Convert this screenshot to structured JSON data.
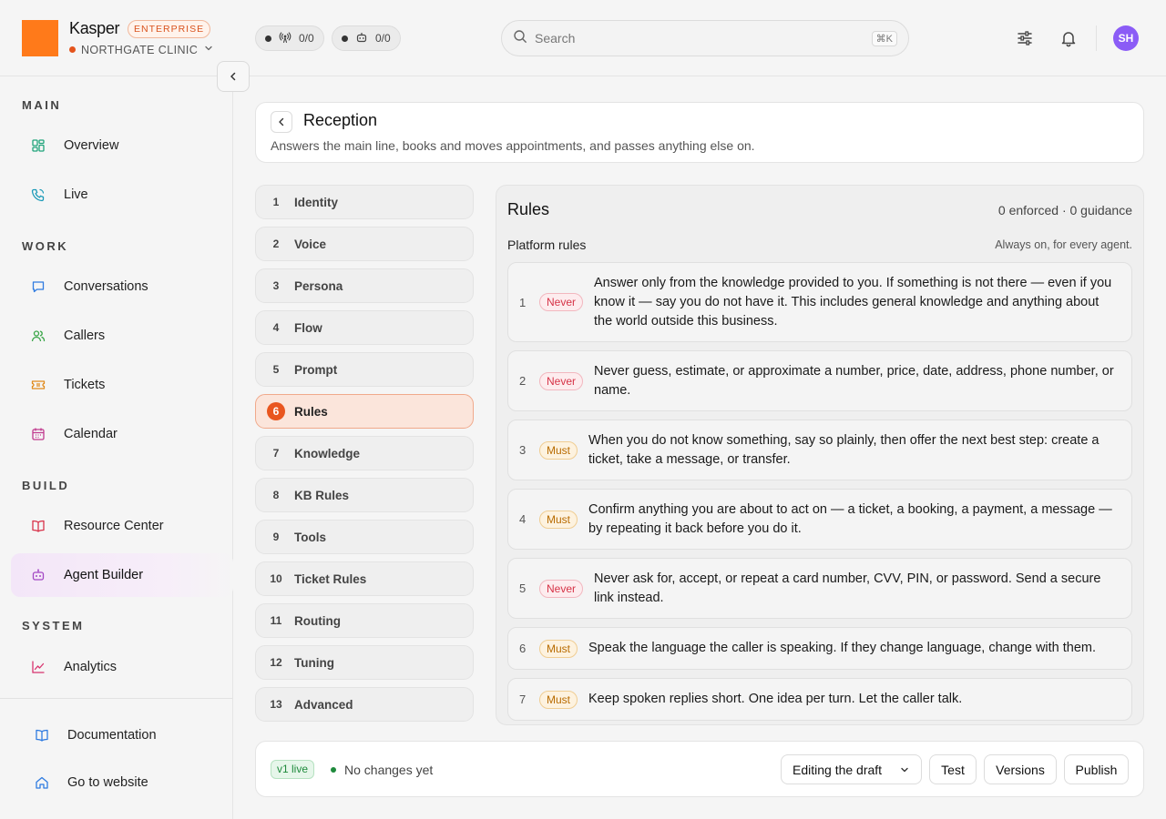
{
  "header": {
    "brand": "Kasper",
    "plan_badge": "ENTERPRISE",
    "org_name": "NORTHGATE CLINIC",
    "chips": [
      {
        "icon": "broadcast-icon",
        "value": "0/0"
      },
      {
        "icon": "robot-icon",
        "value": "0/0"
      }
    ],
    "search": {
      "placeholder": "Search",
      "shortcut": "⌘K"
    },
    "avatar_initials": "SH"
  },
  "sidebar": {
    "sections": [
      {
        "label": "MAIN",
        "items": [
          {
            "label": "Overview",
            "icon": "grid-icon"
          },
          {
            "label": "Live",
            "icon": "phone-icon"
          }
        ]
      },
      {
        "label": "WORK",
        "items": [
          {
            "label": "Conversations",
            "icon": "chat-icon"
          },
          {
            "label": "Callers",
            "icon": "users-icon"
          },
          {
            "label": "Tickets",
            "icon": "ticket-icon"
          },
          {
            "label": "Calendar",
            "icon": "calendar-icon"
          }
        ]
      },
      {
        "label": "BUILD",
        "items": [
          {
            "label": "Resource Center",
            "icon": "book-icon"
          },
          {
            "label": "Agent Builder",
            "icon": "robot-icon",
            "active": true
          }
        ]
      },
      {
        "label": "SYSTEM",
        "items": [
          {
            "label": "Analytics",
            "icon": "chart-icon"
          }
        ]
      }
    ],
    "footer": [
      {
        "label": "Documentation",
        "icon": "book-open-icon"
      },
      {
        "label": "Go to website",
        "icon": "home-icon"
      }
    ]
  },
  "page": {
    "title": "Reception",
    "subtitle": "Answers the main line, books and moves appointments, and passes anything else on."
  },
  "steps": [
    {
      "num": "1",
      "label": "Identity"
    },
    {
      "num": "2",
      "label": "Voice"
    },
    {
      "num": "3",
      "label": "Persona"
    },
    {
      "num": "4",
      "label": "Flow"
    },
    {
      "num": "5",
      "label": "Prompt"
    },
    {
      "num": "6",
      "label": "Rules",
      "active": true
    },
    {
      "num": "7",
      "label": "Knowledge"
    },
    {
      "num": "8",
      "label": "KB Rules"
    },
    {
      "num": "9",
      "label": "Tools"
    },
    {
      "num": "10",
      "label": "Ticket Rules"
    },
    {
      "num": "11",
      "label": "Routing"
    },
    {
      "num": "12",
      "label": "Tuning"
    },
    {
      "num": "13",
      "label": "Advanced"
    }
  ],
  "rules": {
    "title": "Rules",
    "summary": "0 enforced · 0 guidance",
    "platform_title": "Platform rules",
    "platform_note": "Always on, for every agent.",
    "items": [
      {
        "num": "1",
        "type": "Never",
        "text": "Answer only from the knowledge provided to you. If something is not there — even if you know it — say you do not have it. This includes general knowledge and anything about the world outside this business."
      },
      {
        "num": "2",
        "type": "Never",
        "text": "Never guess, estimate, or approximate a number, price, date, address, phone number, or name."
      },
      {
        "num": "3",
        "type": "Must",
        "text": "When you do not know something, say so plainly, then offer the next best step: create a ticket, take a message, or transfer."
      },
      {
        "num": "4",
        "type": "Must",
        "text": "Confirm anything you are about to act on — a ticket, a booking, a payment, a message — by repeating it back before you do it."
      },
      {
        "num": "5",
        "type": "Never",
        "text": "Never ask for, accept, or repeat a card number, CVV, PIN, or password. Send a secure link instead."
      },
      {
        "num": "6",
        "type": "Must",
        "text": "Speak the language the caller is speaking. If they change language, change with them."
      },
      {
        "num": "7",
        "type": "Must",
        "text": "Keep spoken replies short. One idea per turn. Let the caller talk."
      }
    ]
  },
  "footer_bar": {
    "version_badge": "v1 live",
    "status": "No changes yet",
    "mode_select": "Editing the draft",
    "buttons": {
      "test": "Test",
      "versions": "Versions",
      "publish": "Publish"
    }
  },
  "colors": {
    "accent": "#e9561f",
    "brand": "#ff7a1a",
    "never": "#d63347",
    "must": "#b86b00",
    "live": "#1f8a3c"
  }
}
